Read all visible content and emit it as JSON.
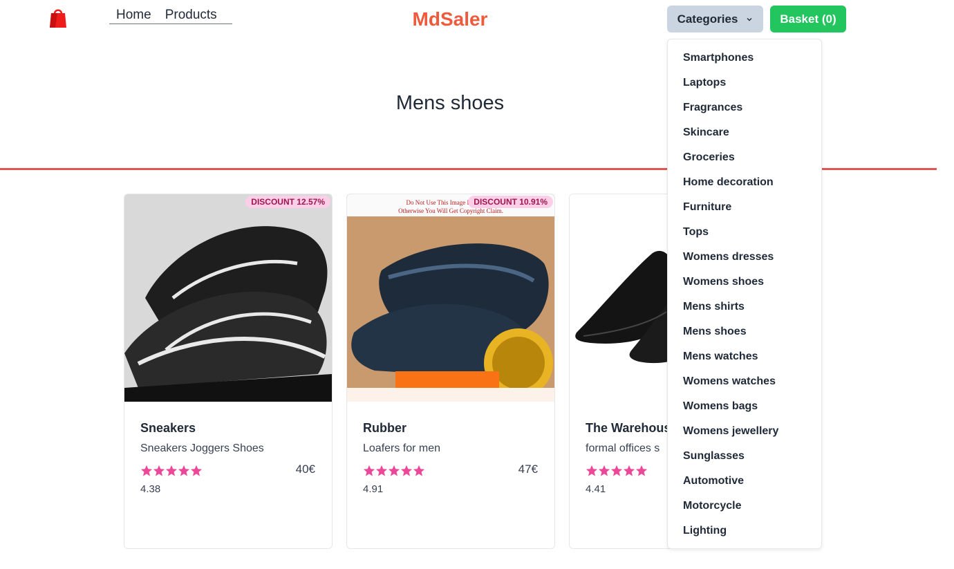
{
  "brand": "MdSaler",
  "nav": {
    "home": "Home",
    "products": "Products"
  },
  "header": {
    "categories_label": "Categories",
    "basket_label": "Basket (0)"
  },
  "page_title": "Mens shoes",
  "colors": {
    "brand": "#ef5a3c",
    "accent_green": "#22c55e",
    "divider": "#e05555",
    "star": "#ec4899"
  },
  "products": [
    {
      "badge": "DISCOUNT 12.57%",
      "title": "Sneakers",
      "desc": "Sneakers Joggers Shoes",
      "price": "40€",
      "rating": "4.38",
      "stars": 5
    },
    {
      "badge": "DISCOUNT 10.91%",
      "title": "Rubber",
      "desc": "Loafers for men",
      "price": "47€",
      "rating": "4.91",
      "stars": 5
    },
    {
      "badge": "",
      "title": "The Warehouse",
      "desc": "formal offices s",
      "price": "",
      "rating": "4.41",
      "stars": 5
    }
  ],
  "categories": [
    "Smartphones",
    "Laptops",
    "Fragrances",
    "Skincare",
    "Groceries",
    "Home decoration",
    "Furniture",
    "Tops",
    "Womens dresses",
    "Womens shoes",
    "Mens shirts",
    "Mens shoes",
    "Mens watches",
    "Womens watches",
    "Womens bags",
    "Womens jewellery",
    "Sunglasses",
    "Automotive",
    "Motorcycle",
    "Lighting"
  ]
}
